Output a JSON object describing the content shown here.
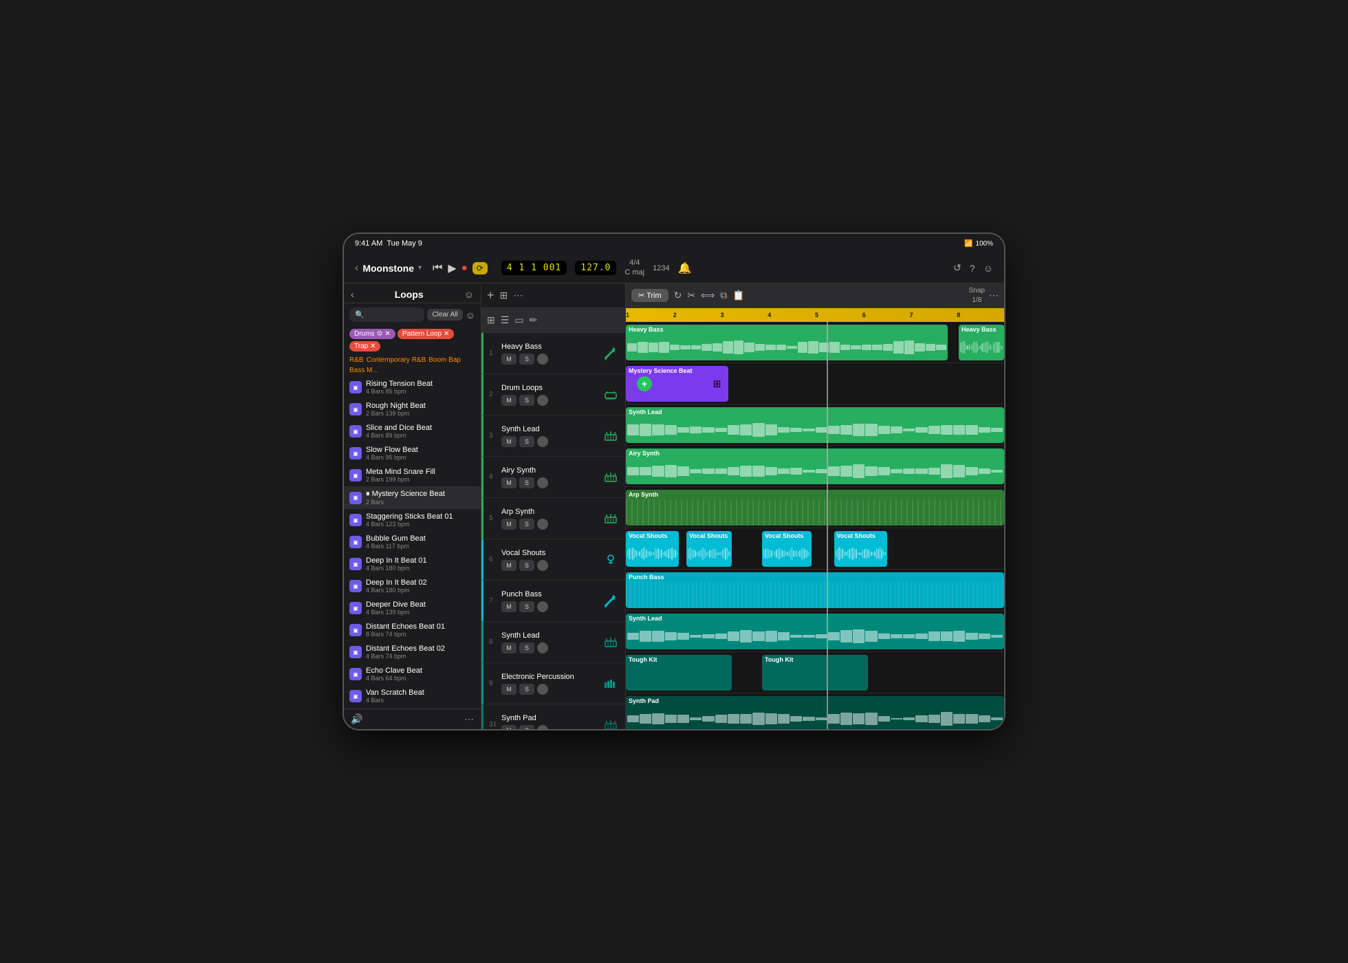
{
  "statusBar": {
    "time": "9:41 AM",
    "date": "Tue May 9",
    "wifi": "WiFi",
    "battery": "100%"
  },
  "header": {
    "title": "Moonstone",
    "backLabel": "‹",
    "transport": {
      "rewind": "⏮",
      "play": "▶",
      "record": "⏺",
      "cycle": "↺",
      "position": "4 1  1 001",
      "bpm": "127.0",
      "signature": "4/4\nC maj",
      "count": "1234"
    },
    "snap": "Snap\n1/8"
  },
  "loopsPanel": {
    "title": "Loops",
    "backBtn": "‹",
    "searchPlaceholder": "🔍",
    "clearAll": "Clear All",
    "tags": [
      {
        "label": "Drums",
        "color": "drums"
      },
      {
        "label": "Pattern Loop",
        "color": "pattern"
      },
      {
        "label": "Trap",
        "color": "trap"
      }
    ],
    "filters": [
      "R&B",
      "Contemporary R&B",
      "Boom Bap",
      "Bass M..."
    ],
    "loops": [
      {
        "name": "Rising Tension Beat",
        "meta": "4 Bars  85 bpm"
      },
      {
        "name": "Rough Night Beat",
        "meta": "2 Bars  139 bpm"
      },
      {
        "name": "Slice and Dice Beat",
        "meta": "4 Bars  89 bpm"
      },
      {
        "name": "Slow Flow Beat",
        "meta": "4 Bars  95 bpm"
      },
      {
        "name": "Meta Mind Snare Fill",
        "meta": "2 Bars  199 bpm"
      },
      {
        "name": "Mystery Science Beat",
        "meta": "2 Bars",
        "playing": true
      },
      {
        "name": "Staggering Sticks Beat 01",
        "meta": "4 Bars  123 bpm"
      },
      {
        "name": "Bubble Gum Beat",
        "meta": "4 Bars  117 bpm"
      },
      {
        "name": "Deep In It Beat 01",
        "meta": "4 Bars  180 bpm"
      },
      {
        "name": "Deep In It Beat 02",
        "meta": "4 Bars  180 bpm"
      },
      {
        "name": "Deeper Dive Beat",
        "meta": "4 Bars  139 bpm"
      },
      {
        "name": "Distant Echoes Beat 01",
        "meta": "8 Bars  74 bpm"
      },
      {
        "name": "Distant Echoes Beat 02",
        "meta": "4 Bars  74 bpm"
      },
      {
        "name": "Echo Clave Beat",
        "meta": "4 Bars  64 bpm"
      },
      {
        "name": "Van Scratch Beat",
        "meta": "4 Bars"
      }
    ]
  },
  "editToolbar": {
    "trim": "Trim",
    "trimIcon": "✂",
    "moreOptions": "⋯"
  },
  "tracks": [
    {
      "num": "1",
      "name": "Heavy Bass",
      "color": "#27ae60",
      "instrument": "🎸"
    },
    {
      "num": "2",
      "name": "Drum Loops",
      "color": "#27ae60",
      "instrument": "🥁"
    },
    {
      "num": "3",
      "name": "Synth Lead",
      "color": "#27ae60",
      "instrument": "🎹"
    },
    {
      "num": "4",
      "name": "Airy Synth",
      "color": "#27ae60",
      "instrument": "🎹"
    },
    {
      "num": "5",
      "name": "Arp Synth",
      "color": "#27ae60",
      "instrument": "🎹"
    },
    {
      "num": "6",
      "name": "Vocal Shouts",
      "color": "#00bcd4",
      "instrument": "🎤"
    },
    {
      "num": "7",
      "name": "Punch Bass",
      "color": "#00bcd4",
      "instrument": "🎸"
    },
    {
      "num": "8",
      "name": "Synth Lead",
      "color": "#009688",
      "instrument": "🎹"
    },
    {
      "num": "9",
      "name": "Electronic Percussion",
      "color": "#009688",
      "instrument": "🎹"
    },
    {
      "num": "31",
      "name": "Synth Pad",
      "color": "#00796b",
      "instrument": "🎹"
    }
  ],
  "timeline": {
    "rulerMarks": [
      "1",
      "2",
      "3",
      "4",
      "5",
      "6",
      "7",
      "8"
    ],
    "clips": {
      "track1": [
        {
          "label": "Heavy Bass",
          "color": "#27ae60",
          "left": "0%",
          "width": "85%",
          "hasWave": true
        },
        {
          "label": "Heavy Bass",
          "color": "#27ae60",
          "left": "88%",
          "width": "12%",
          "hasWave": true
        }
      ],
      "track2": [
        {
          "label": "Mystery Science Beat",
          "color": "#7c3aed",
          "left": "0%",
          "width": "27%",
          "hasWave": false,
          "adding": true
        }
      ],
      "track3": [
        {
          "label": "Synth Lead",
          "color": "#27ae60",
          "left": "0%",
          "width": "100%",
          "hasWave": true
        }
      ],
      "track4": [
        {
          "label": "Airy Synth",
          "color": "#27ae60",
          "left": "0%",
          "width": "100%",
          "hasWave": true
        }
      ],
      "track5": [
        {
          "label": "Arp Synth",
          "color": "#2e7d32",
          "left": "0%",
          "width": "100%",
          "hasWave": false
        }
      ],
      "track6": [
        {
          "label": "Vocal Shouts",
          "color": "#00bcd4",
          "left": "0%",
          "width": "14%",
          "hasWave": true
        },
        {
          "label": "Vocal Shouts",
          "color": "#00bcd4",
          "left": "16%",
          "width": "12%",
          "hasWave": true
        },
        {
          "label": "Vocal Shouts",
          "color": "#00bcd4",
          "left": "36%",
          "width": "13%",
          "hasWave": true
        },
        {
          "label": "Vocal Shouts",
          "color": "#00bcd4",
          "left": "55%",
          "width": "14%",
          "hasWave": true
        }
      ],
      "track7": [
        {
          "label": "Punch Bass",
          "color": "#00acc1",
          "left": "0%",
          "width": "100%",
          "hasWave": false
        }
      ],
      "track8": [
        {
          "label": "Synth Lead",
          "color": "#00897b",
          "left": "0%",
          "width": "100%",
          "hasWave": true
        }
      ],
      "track9": [
        {
          "label": "Tough Kit",
          "color": "#00695c",
          "left": "0%",
          "width": "28%",
          "hasWave": false
        },
        {
          "label": "Tough Kit",
          "color": "#00695c",
          "left": "36%",
          "width": "28%",
          "hasWave": false
        }
      ],
      "track31": [
        {
          "label": "Synth Pad",
          "color": "#004d40",
          "left": "0%",
          "width": "100%",
          "hasWave": true
        }
      ]
    }
  },
  "bottomBar": {
    "icons": [
      "📁",
      "ℹ",
      "☰",
      "✏",
      "☀",
      "≡",
      "⟪"
    ]
  }
}
